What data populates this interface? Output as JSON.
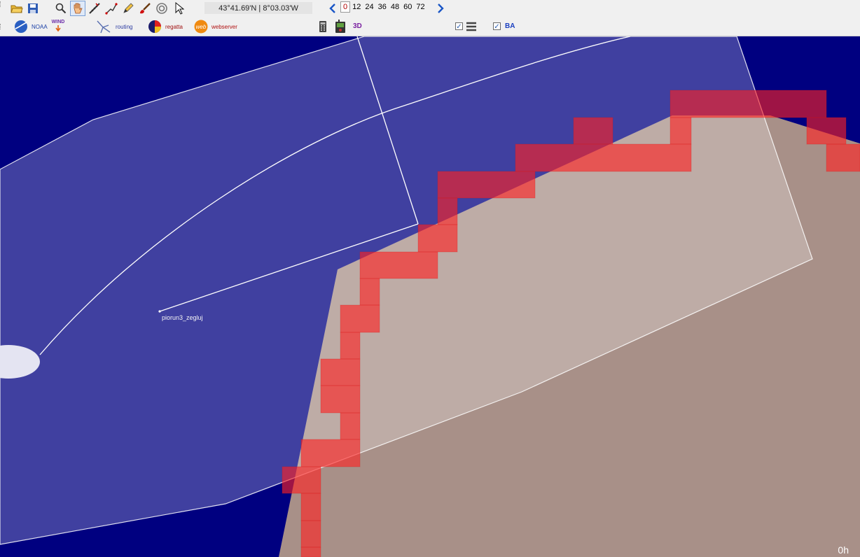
{
  "toolbar": {
    "coordinates": "43°41.69'N | 8°03.03'W",
    "hours": [
      "0",
      "12",
      "24",
      "36",
      "48",
      "60",
      "72"
    ],
    "selected_hour": "0",
    "noaa_label": "NOAA",
    "wind_label": "WIND",
    "routing_label": "routing",
    "regatta_label": "regatta",
    "webserver_label": "webserver",
    "web_icon_text": "web",
    "threed_label": "3D",
    "ba_label": "BA",
    "layers_checked": true,
    "ba_checked": true
  },
  "map": {
    "boat_label": "piorun3_zegluj",
    "time_label": "0h",
    "colors": {
      "sea": "#000080",
      "land": "#a89088",
      "overlay": "#ffffff",
      "grid_cell": "#ff2020"
    }
  }
}
